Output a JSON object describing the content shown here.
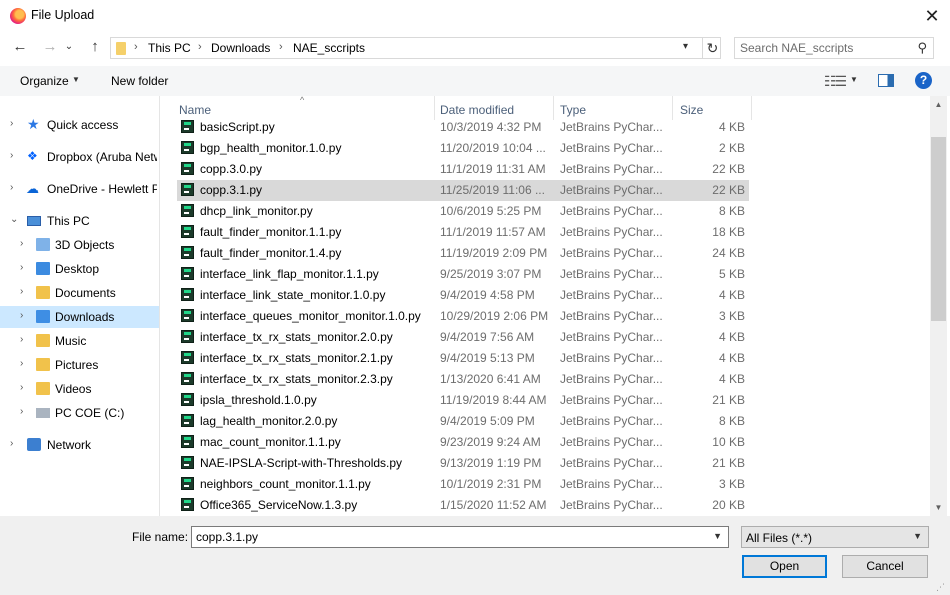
{
  "window": {
    "title": "File Upload",
    "close_glyph": "✕"
  },
  "nav": {
    "back_glyph": "←",
    "forward_glyph": "→",
    "recent_glyph": "⌄",
    "up_glyph": "↑",
    "breadcrumb": [
      "This PC",
      "Downloads",
      "NAE_sccripts"
    ],
    "separator": "›",
    "refresh_glyph": "↻",
    "search_placeholder": "Search NAE_sccripts",
    "search_glyph": "⚲"
  },
  "toolbar": {
    "organize": "Organize",
    "new_folder": "New folder",
    "help": "?"
  },
  "sidebar": {
    "items": [
      {
        "label": "Quick access",
        "icon": "star-icon",
        "chev": "›"
      },
      {
        "label": "Dropbox (Aruba Netw",
        "icon": "dropbox-icon",
        "chev": "›"
      },
      {
        "label": "OneDrive - Hewlett P",
        "icon": "cloud-icon",
        "chev": "›"
      },
      {
        "label": "This PC",
        "icon": "computer-icon",
        "chev": "⌄"
      },
      {
        "label": "3D Objects",
        "icon": "3d-objects-icon",
        "chev": "›"
      },
      {
        "label": "Desktop",
        "icon": "desktop-icon",
        "chev": "›"
      },
      {
        "label": "Documents",
        "icon": "documents-icon",
        "chev": "›"
      },
      {
        "label": "Downloads",
        "icon": "downloads-icon",
        "chev": "›"
      },
      {
        "label": "Music",
        "icon": "music-icon",
        "chev": "›"
      },
      {
        "label": "Pictures",
        "icon": "pictures-icon",
        "chev": "›"
      },
      {
        "label": "Videos",
        "icon": "videos-icon",
        "chev": "›"
      },
      {
        "label": "PC COE (C:)",
        "icon": "drive-icon",
        "chev": "›"
      },
      {
        "label": "Network",
        "icon": "network-icon",
        "chev": "›"
      }
    ],
    "selected": "Downloads"
  },
  "columns": {
    "name": "Name",
    "date": "Date modified",
    "type": "Type",
    "size": "Size"
  },
  "files": [
    {
      "name": "basicScript.py",
      "date": "10/3/2019 4:32 PM",
      "type": "JetBrains PyChar...",
      "size": "4 KB"
    },
    {
      "name": "bgp_health_monitor.1.0.py",
      "date": "11/20/2019 10:04 ...",
      "type": "JetBrains PyChar...",
      "size": "2 KB"
    },
    {
      "name": "copp.3.0.py",
      "date": "11/1/2019 11:31 AM",
      "type": "JetBrains PyChar...",
      "size": "22 KB"
    },
    {
      "name": "copp.3.1.py",
      "date": "11/25/2019 11:06 ...",
      "type": "JetBrains PyChar...",
      "size": "22 KB"
    },
    {
      "name": "dhcp_link_monitor.py",
      "date": "10/6/2019 5:25 PM",
      "type": "JetBrains PyChar...",
      "size": "8 KB"
    },
    {
      "name": "fault_finder_monitor.1.1.py",
      "date": "11/1/2019 11:57 AM",
      "type": "JetBrains PyChar...",
      "size": "18 KB"
    },
    {
      "name": "fault_finder_monitor.1.4.py",
      "date": "11/19/2019 2:09 PM",
      "type": "JetBrains PyChar...",
      "size": "24 KB"
    },
    {
      "name": "interface_link_flap_monitor.1.1.py",
      "date": "9/25/2019 3:07 PM",
      "type": "JetBrains PyChar...",
      "size": "5 KB"
    },
    {
      "name": "interface_link_state_monitor.1.0.py",
      "date": "9/4/2019 4:58 PM",
      "type": "JetBrains PyChar...",
      "size": "4 KB"
    },
    {
      "name": "interface_queues_monitor_monitor.1.0.py",
      "date": "10/29/2019 2:06 PM",
      "type": "JetBrains PyChar...",
      "size": "3 KB"
    },
    {
      "name": "interface_tx_rx_stats_monitor.2.0.py",
      "date": "9/4/2019 7:56 AM",
      "type": "JetBrains PyChar...",
      "size": "4 KB"
    },
    {
      "name": "interface_tx_rx_stats_monitor.2.1.py",
      "date": "9/4/2019 5:13 PM",
      "type": "JetBrains PyChar...",
      "size": "4 KB"
    },
    {
      "name": "interface_tx_rx_stats_monitor.2.3.py",
      "date": "1/13/2020 6:41 AM",
      "type": "JetBrains PyChar...",
      "size": "4 KB"
    },
    {
      "name": "ipsla_threshold.1.0.py",
      "date": "11/19/2019 8:44 AM",
      "type": "JetBrains PyChar...",
      "size": "21 KB"
    },
    {
      "name": "lag_health_monitor.2.0.py",
      "date": "9/4/2019 5:09 PM",
      "type": "JetBrains PyChar...",
      "size": "8 KB"
    },
    {
      "name": "mac_count_monitor.1.1.py",
      "date": "9/23/2019 9:24 AM",
      "type": "JetBrains PyChar...",
      "size": "10 KB"
    },
    {
      "name": "NAE-IPSLA-Script-with-Thresholds.py",
      "date": "9/13/2019 1:19 PM",
      "type": "JetBrains PyChar...",
      "size": "21 KB"
    },
    {
      "name": "neighbors_count_monitor.1.1.py",
      "date": "10/1/2019 2:31 PM",
      "type": "JetBrains PyChar...",
      "size": "3 KB"
    },
    {
      "name": "Office365_ServiceNow.1.3.py",
      "date": "1/15/2020 11:52 AM",
      "type": "JetBrains PyChar...",
      "size": "20 KB"
    }
  ],
  "selected_file": "copp.3.1.py",
  "bottom": {
    "file_name_label": "File name:",
    "file_name_value": "copp.3.1.py",
    "file_type": "All Files (*.*)",
    "open": "Open",
    "cancel": "Cancel"
  },
  "colors": {
    "accent": "#0078d7",
    "selected_nav": "#cce8ff",
    "selected_row": "#d9d9d9"
  }
}
